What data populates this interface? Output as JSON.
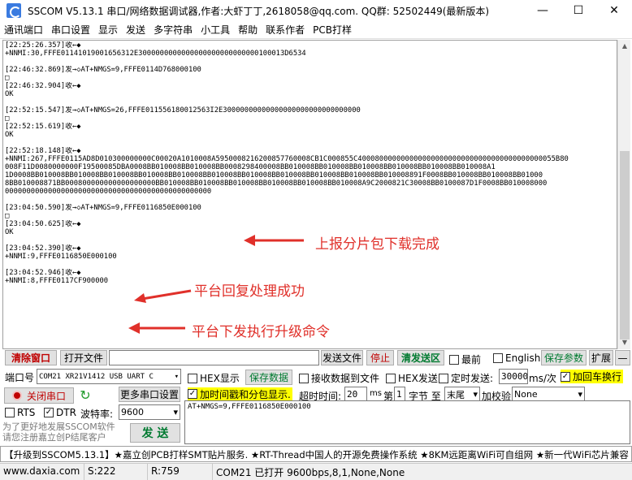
{
  "window": {
    "title": "SSCOM V5.13.1 串口/网络数据调试器,作者:大虾丁丁,2618058@qq.com. QQ群: 52502449(最新版本)",
    "minimize": "—",
    "maximize": "☐",
    "close": "✕"
  },
  "menu": [
    "通讯端口",
    "串口设置",
    "显示",
    "发送",
    "多字符串",
    "小工具",
    "帮助",
    "联系作者",
    "PCB打样"
  ],
  "log": [
    "[22:25:26.357]收←◆",
    "+NNMI:30,FFFE01141019001656312E3000000000000000000000000000100013D6534",
    "",
    "[22:46:32.869]发→◇AT+NMGS=9,FFFE0114D768000100",
    "□",
    "[22:46:32.904]收←◆",
    "OK",
    "",
    "[22:52:15.547]发→◇AT+NMGS=26,FFFE011556180012563I2E30000000000000000000000000000000",
    "□",
    "[22:52:15.619]收←◆",
    "OK",
    "",
    "[22:52:18.148]收←◆",
    "+NNMI:267,FFFE0115AD8D010300000000C00020A1010008A5950008216200857760008CB1C000855C4000800000000000000000000000000000000000000055B80",
    "008F11D0080000000F19500085DBA0008BB010008BB010008BB0008298400008BB010008BB010008BB010008BB010008BB010008BB010008A1",
    "1D0008BB010008BB010008BB010008BB010008BB010008BB010008BB010008BB010008BB010008BB010008BB010008891F0008BB010008BB010008BB01000",
    "8BB010008871BB000800000000000000000BB010008BB010008BB010008BB010008BB010008BB010008A9C2000821C30008BB0100087D1F0008BB010008000",
    "000000000000000000000000000000000000000000000000",
    "",
    "[23:04:50.590]发→◇AT+NMGS=9,FFFE0116850E000100",
    "□",
    "[23:04:50.625]收←◆",
    "OK",
    "",
    "[23:04:52.390]收←◆",
    "+NNMI:9,FFFE0116850E000100",
    "",
    "[23:04:52.946]收←◆",
    "+NNMI:8,FFFE0117CF900000",
    "",
    "",
    "",
    "",
    "",
    "",
    "",
    ""
  ],
  "annotations": {
    "a1": "上报分片包下载完成",
    "a2": "平台回复处理成功",
    "a3": "平台下发执行升级命令",
    "color": "#e0302a"
  },
  "toolbar": {
    "clear": "清除窗口",
    "open_file": "打开文件",
    "send_file": "发送文件",
    "stop": "停止",
    "clear_send": "清发送区",
    "topmost": "最前",
    "english": "English",
    "save_params": "保存参数",
    "expand": "扩展",
    "collapse": "—"
  },
  "settings": {
    "port_label": "端口号",
    "port_value": "COM21 XR21V1412 USB UART C",
    "hex_display": "HEX显示",
    "save_data": "保存数据",
    "recv_to_file": "接收数据到文件",
    "hex_send": "HEX发送",
    "timed_send": "定时发送:",
    "interval": "30000",
    "interval_unit": "ms/次",
    "add_crlf": "加回车换行",
    "close_port": "关闭串口",
    "more_settings": "更多串口设置",
    "timestamp": "加时间戳和分包显示.",
    "timeout_label": "超时时间:",
    "timeout_value": "20",
    "timeout_unit": "ms",
    "nth": "第",
    "nth_value": "1",
    "byte_to": "字节 至",
    "tail": "末尾",
    "checksum": "加校验",
    "checksum_value": "None",
    "rts": "RTS",
    "dtr": "DTR",
    "baud_label": "波特率:",
    "baud_value": "9600",
    "send_input": "AT+NMGS=9,FFFE0116850E000100",
    "send_button": "发 送",
    "promo": "为了更好地发展SSCOM软件\n请您注册嘉立创P结尾客户"
  },
  "ticker": "【升级到SSCOM5.13.1】★嘉立创PCB打样SMT贴片服务. ★RT-Thread中国人的开源免费操作系统 ★8KM远距离WiFi可自组网 ★新一代WiFi芯片兼容",
  "status": {
    "url": "www.daxia.com",
    "sent": "S:222",
    "recv": "R:759",
    "port_state": "COM21 已打开  9600bps,8,1,None,None"
  }
}
